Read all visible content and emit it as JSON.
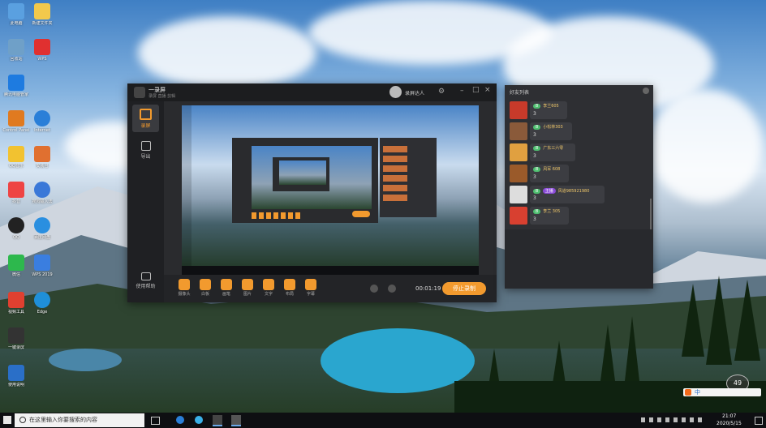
{
  "desktop": {
    "icons": [
      {
        "label": "此电脑",
        "color": "#5aa0e0"
      },
      {
        "label": "回收站",
        "color": "#6fa0c8"
      },
      {
        "label": "腾讯电脑管家",
        "color": "#1e7be0"
      },
      {
        "label": "Control Panel",
        "color": "#e07a20"
      },
      {
        "label": "QQ音乐",
        "color": "#f2c230"
      },
      {
        "label": "抖音",
        "color": "#e44"
      },
      {
        "label": "QQ",
        "color": "#222"
      },
      {
        "label": "微信",
        "color": "#2db84d"
      },
      {
        "label": "视频工具",
        "color": "#e04030"
      },
      {
        "label": "一键录屏",
        "color": "#333"
      },
      {
        "label": "使用说明",
        "color": "#2a6fc8"
      }
    ],
    "icons_col2": [
      {
        "label": "新建文件夹",
        "color": "#f2c94c"
      },
      {
        "label": "WPS",
        "color": "#e03030"
      },
      {
        "label": "Internet",
        "color": "#2a7fd8"
      },
      {
        "label": "安装包",
        "color": "#e07030"
      },
      {
        "label": "搜狗输入法",
        "color": "#3a78d8"
      },
      {
        "label": "百度网盘",
        "color": "#2a8fe0"
      },
      {
        "label": "WPS 2019",
        "color": "#3a7ee0"
      },
      {
        "label": "Edge",
        "color": "#1f8fd8"
      }
    ]
  },
  "recorder": {
    "app_title": "一录屏",
    "app_subtitle": "录屏 直播 剪辑",
    "username": "录屏达人",
    "sidebar": [
      {
        "label": "录屏",
        "icon": "camera-icon"
      },
      {
        "label": "导出",
        "icon": "export-icon"
      },
      {
        "label": "使用帮助",
        "icon": "help-chat-icon"
      }
    ],
    "tools": [
      {
        "label": "摄像头",
        "icon": "webcam-icon"
      },
      {
        "label": "白板",
        "icon": "whiteboard-icon"
      },
      {
        "label": "画笔",
        "icon": "brush-icon"
      },
      {
        "label": "图片",
        "icon": "image-icon"
      },
      {
        "label": "文字",
        "icon": "text-icon"
      },
      {
        "label": "布局",
        "icon": "layout-icon"
      },
      {
        "label": "字幕",
        "icon": "subtitle-icon"
      }
    ],
    "timer": "00:01:19",
    "stop_label": "停止录制",
    "accent": "#f29a2e"
  },
  "cam_list": {
    "title": "好友列表",
    "items": [
      {
        "level": "8",
        "name": "李兰605",
        "num": "3",
        "avatar_color": "#c83a2a"
      },
      {
        "level": "8",
        "name": "小松林303",
        "num": "3",
        "avatar_color": "#8a5a3a"
      },
      {
        "level": "8",
        "name": "广东三六零",
        "num": "3",
        "avatar_color": "#e0a040"
      },
      {
        "level": "8",
        "name": "风军 608",
        "num": "3",
        "avatar_color": "#9a5a2a"
      },
      {
        "level": "8",
        "name": "风道985921980",
        "num": "3",
        "avatar_color": "#dddddd",
        "tag": "主播"
      },
      {
        "level": "8",
        "name": "李兰 305",
        "num": "3",
        "avatar_color": "#d84030"
      }
    ]
  },
  "taskbar": {
    "search_placeholder": "在这里输入你要搜索的内容",
    "time": "21:07",
    "date": "2020/5/15",
    "ime": "中",
    "badge": "49"
  }
}
